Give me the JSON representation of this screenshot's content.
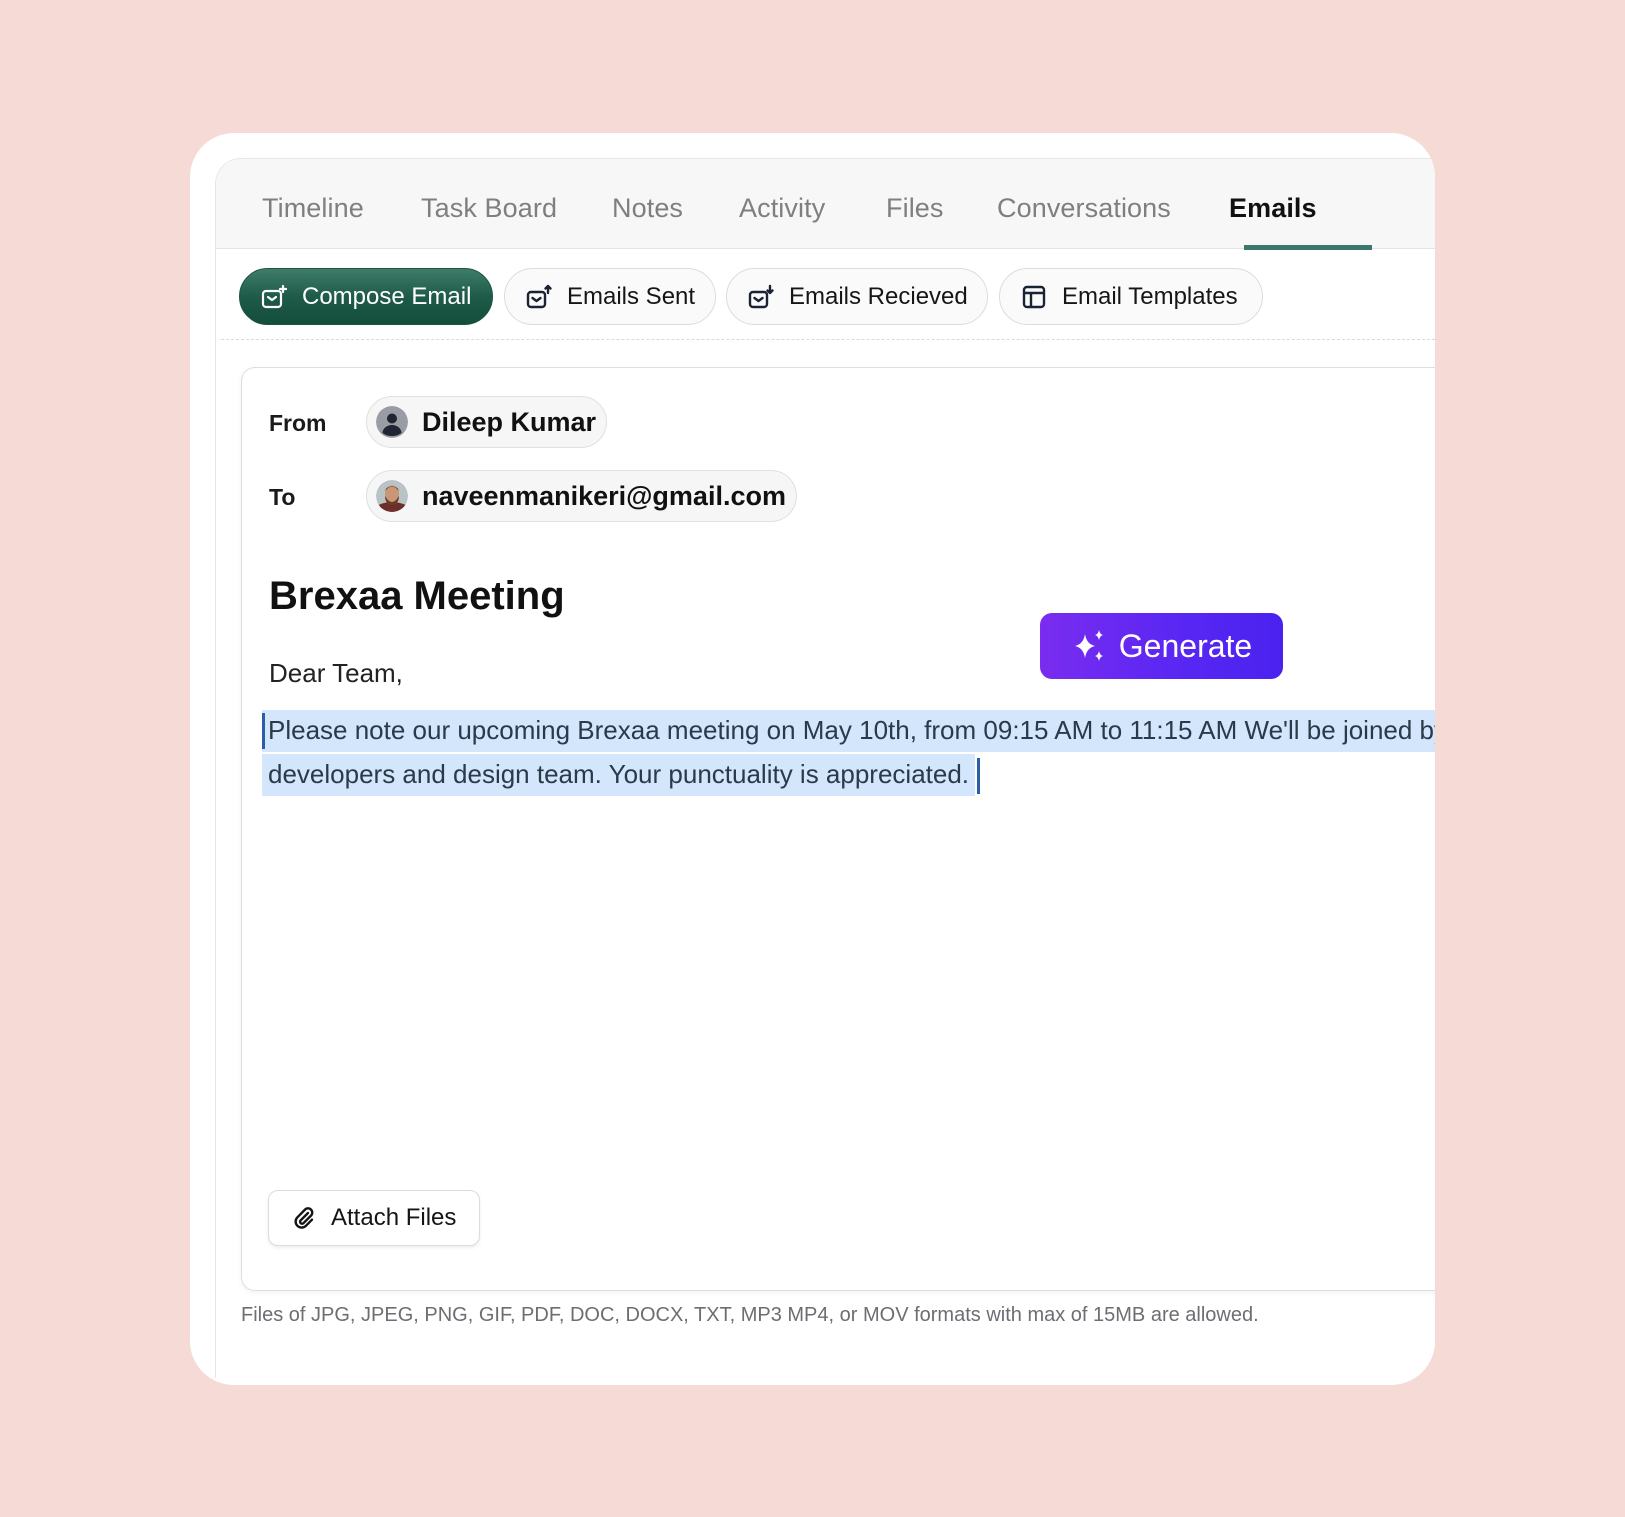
{
  "tabs": [
    {
      "label": "Timeline",
      "active": false
    },
    {
      "label": "Task Board",
      "active": false
    },
    {
      "label": "Notes",
      "active": false
    },
    {
      "label": "Activity",
      "active": false
    },
    {
      "label": "Files",
      "active": false
    },
    {
      "label": "Conversations",
      "active": false
    },
    {
      "label": "Emails",
      "active": true
    }
  ],
  "actions": {
    "compose": {
      "label": "Compose Email",
      "icon": "mail-plus-icon"
    },
    "sent": {
      "label": "Emails Sent",
      "icon": "mail-send-icon"
    },
    "received": {
      "label": "Emails Recieved",
      "icon": "mail-receive-icon"
    },
    "templates": {
      "label": "Email Templates",
      "icon": "template-icon"
    }
  },
  "compose": {
    "from_label": "From",
    "from_value": "Dileep Kumar",
    "to_label": "To",
    "to_value": "naveenmanikeri@gmail.com",
    "subject": "Brexaa Meeting",
    "greeting": "Dear Team,",
    "body_line1": "Please note our upcoming Brexaa meeting on May 10th, from  09:15 AM to 11:15 AM  We'll be joined by our developers",
    "body_line2": "developers and design team. Your punctuality is appreciated.",
    "generate_label": "Generate",
    "attach_label": "Attach Files",
    "hint": "Files of JPG, JPEG, PNG, GIF, PDF, DOC, DOCX, TXT, MP3 MP4, or MOV formats with max of 15MB are allowed."
  },
  "colors": {
    "brand_green": "#1e5b48",
    "tab_active_underline": "#3b7a6b",
    "generate_gradient_start": "#7a2cf0",
    "generate_gradient_end": "#4a22ef",
    "selection": "#d3e6fb",
    "page_background": "#f5dad6"
  }
}
